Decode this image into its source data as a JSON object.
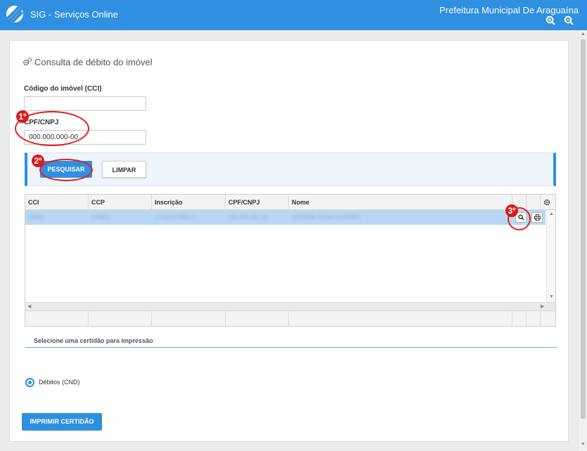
{
  "header": {
    "app_title": "SIG - Serviços Online",
    "organization": "Prefeitura Municipal De Araguaína",
    "zoom_in_icon": "zoom-in-icon",
    "zoom_out_icon": "zoom-out-icon"
  },
  "page": {
    "title": "Consulta de débito do imóvel",
    "title_icon": "gears-icon"
  },
  "form": {
    "cci_label": "Código do imóvel (CCI)",
    "cci_value": "",
    "cpf_label": "CPF/CNPJ",
    "cpf_value": "000.000.000-00"
  },
  "actions": {
    "search_label": "PESQUISAR",
    "clear_label": "LIMPAR"
  },
  "annotations": [
    "1º",
    "2º",
    "3º"
  ],
  "grid": {
    "columns": [
      "CCI",
      "CCP",
      "Inscrição",
      "CPF/CNPJ",
      "Nome"
    ],
    "rows": [
      {
        "cci": "30305",
        "ccp": "220903",
        "inscricao": "1.4.0013.0002.1",
        "cpf": "025.035.361-06",
        "nome": "HUDSON SILVA OLIVEIRA"
      }
    ],
    "settings_icon": "gear-icon",
    "view_icon": "search-icon",
    "print_icon": "printer-icon"
  },
  "certificate": {
    "section_title": "Selecione uma certidão para impressão",
    "option_label": "Débitos (CND)",
    "print_label": "IMPRIMIR CERTIDÃO"
  },
  "colors": {
    "primary": "#2f8fe0",
    "annotation": "#d81b1b",
    "row_selected": "#b9d7f4"
  }
}
